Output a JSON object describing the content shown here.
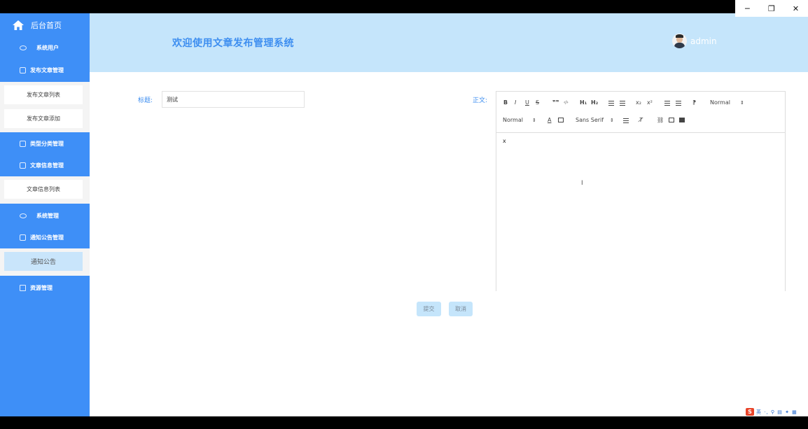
{
  "window": {
    "minimize_glyph": "─",
    "restore_glyph": "❐",
    "close_glyph": "✕"
  },
  "sidebar": {
    "home_label": "后台首页",
    "groups": [
      {
        "label": "系统用户",
        "icon": "cloud-icon"
      },
      {
        "label": "发布文章管理",
        "icon": "edit-icon",
        "subs": [
          "发布文章列表",
          "发布文章添加"
        ]
      },
      {
        "label": "类型分类管理",
        "icon": "list-icon"
      },
      {
        "label": "文章信息管理",
        "icon": "edit-icon",
        "subs": [
          "文章信息列表"
        ]
      },
      {
        "label": "系统管理",
        "icon": "cloud-icon"
      },
      {
        "label": "通知公告管理",
        "icon": "list-icon",
        "subs": [
          "通知公告"
        ]
      },
      {
        "label": "资源管理",
        "icon": "download-icon"
      }
    ]
  },
  "header": {
    "title": "欢迎使用文章发布管理系统",
    "username": "admin"
  },
  "form": {
    "title_label": "标题:",
    "title_value": "测试",
    "body_label": "正文:",
    "body_text": "x",
    "submit_label": "提交",
    "cancel_label": "取消"
  },
  "editor_toolbar": {
    "bold": "B",
    "italic": "I",
    "underline": "U",
    "strike": "S",
    "blockquote": "❞❞",
    "code": "‹/›",
    "h1": "H₁",
    "h2": "H₂",
    "subscript": "x₂",
    "superscript": "x²",
    "direction": "⁋",
    "size_select": "Normal",
    "header_select": "Normal",
    "font_select": "Sans Serif",
    "font_color": "A",
    "clean": "T̸"
  },
  "tray": {
    "logo": "S",
    "items": "英 ·, ⚲ ▤ ✦ ▦"
  },
  "colors": {
    "sidebar": "#3e8ff7",
    "header": "#c5e5fb",
    "accent": "#3d8ef0"
  }
}
